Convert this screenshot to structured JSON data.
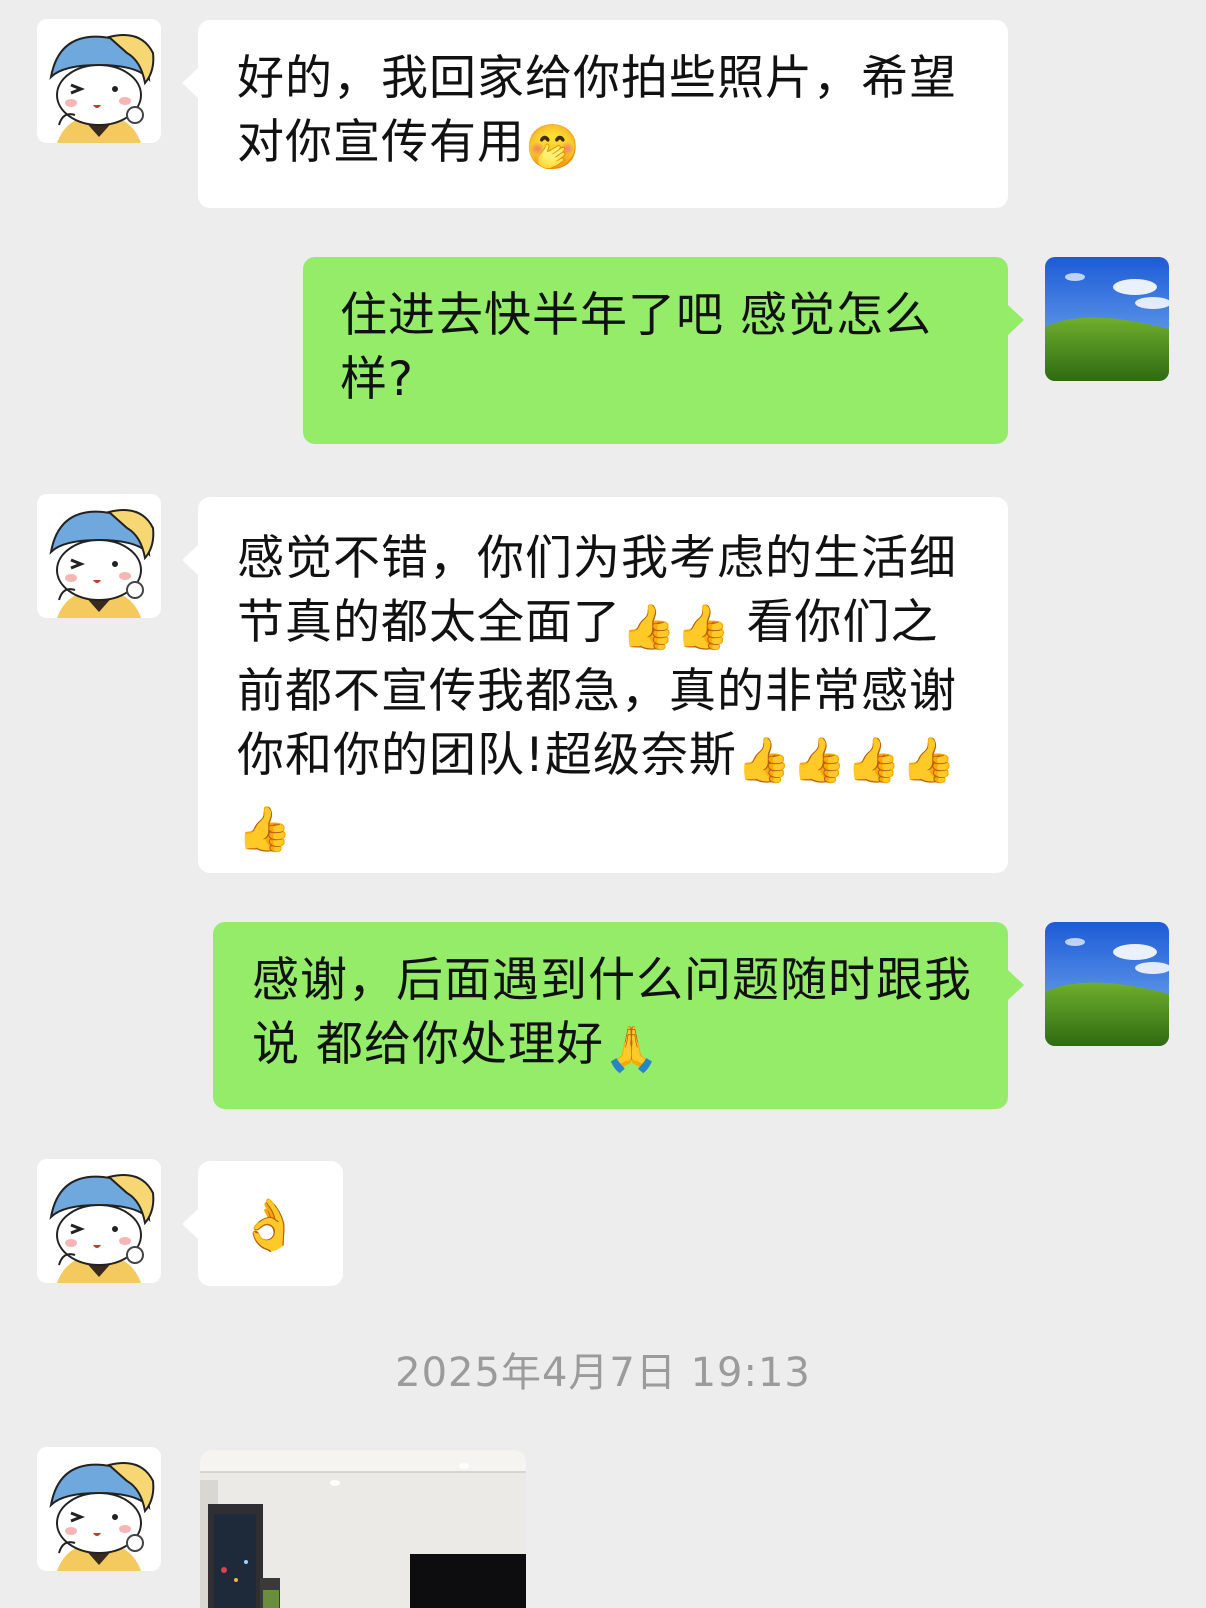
{
  "messages": [
    {
      "side": "left",
      "text": "好的，我回家给你拍些照片，希望对你宣传有用",
      "emoji": "🤭"
    },
    {
      "side": "right",
      "text": "住进去快半年了吧 感觉怎么样?"
    },
    {
      "side": "left",
      "text": "感觉不错，你们为我考虑的生活细节真的都太全面了",
      "emoji": "👍👍",
      "text2": " 看你们之前都不宣传我都急，真的非常感谢你和你的团队!超级奈斯",
      "emoji2": "👍👍👍👍👍"
    },
    {
      "side": "right",
      "text": "感谢，后面遇到什么问题随时跟我说 都给你处理好",
      "emoji": "🙏"
    },
    {
      "side": "left",
      "emoji": "👌"
    }
  ],
  "timestamp": "2025年4月7日 19:13",
  "icons": {
    "left_avatar": "cartoon-girl-avatar",
    "right_avatar": "green-hills-blue-sky-avatar",
    "photo": "room-interior-photo"
  },
  "colors": {
    "background": "#ededed",
    "left_bubble": "#ffffff",
    "right_bubble": "#95ec69",
    "timestamp": "#9b9b9b"
  }
}
